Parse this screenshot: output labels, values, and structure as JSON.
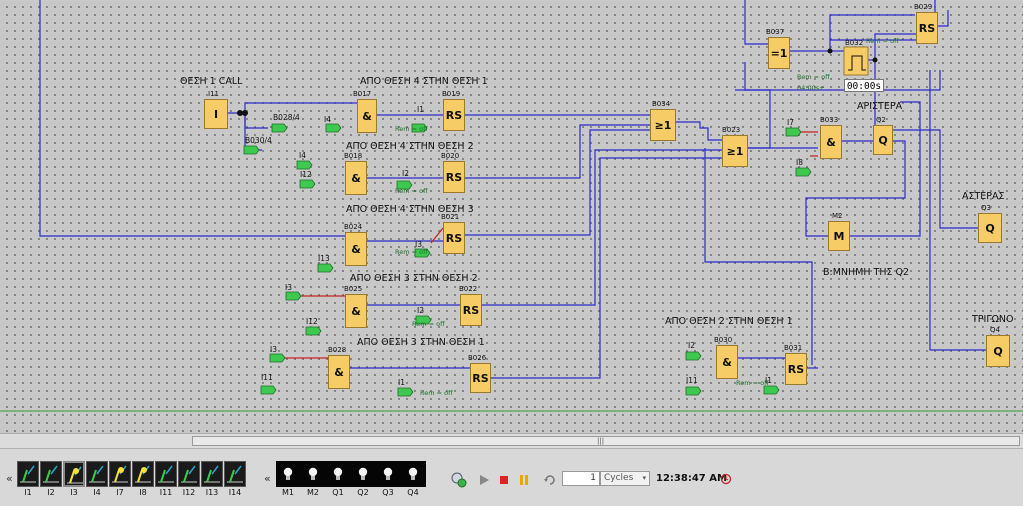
{
  "canvas": {
    "captions": [
      {
        "key": "c1",
        "text": "ΘΕΣΗ 1 CALL"
      },
      {
        "key": "c2",
        "text": "ΑΠΟ ΘΕΣΗ 4 ΣΤΗΝ ΘΕΣΗ 1"
      },
      {
        "key": "c3",
        "text": "ΑΠΟ ΘΕΣΗ 4 ΣΤΗΝ ΘΕΣΗ 2"
      },
      {
        "key": "c4",
        "text": "ΑΠΟ ΘΕΣΗ 4 ΣΤΗΝ ΘΕΣΗ 3"
      },
      {
        "key": "c5",
        "text": "ΑΠΟ ΘΕΣΗ 3 ΣΤΗΝ ΘΕΣΗ 2"
      },
      {
        "key": "c6",
        "text": "ΑΠΟ ΘΕΣΗ 3 ΣΤΗΝ ΘΕΣΗ 1"
      },
      {
        "key": "c7",
        "text": "ΑΠΟ ΘΕΣΗ 2 ΣΤΗΝ ΘΕΣΗ 1"
      },
      {
        "key": "c8",
        "text": "ΑΡΙΣΤΕΡΑ"
      },
      {
        "key": "c9",
        "text": "Β:ΜΝΗΜΗ ΤΗΣ Q2"
      },
      {
        "key": "c10",
        "text": "ΑΣΤΕΡΑΣ"
      },
      {
        "key": "c11",
        "text": "ΤΡΙΓΩΝΟ"
      }
    ],
    "blocks": [
      {
        "key": "I11",
        "id": "I11",
        "sym": "I"
      },
      {
        "key": "B017",
        "id": "B017",
        "sym": "&"
      },
      {
        "key": "B019",
        "id": "B019",
        "sym": "RS"
      },
      {
        "key": "B018",
        "id": "B018",
        "sym": "&"
      },
      {
        "key": "B020",
        "id": "B020",
        "sym": "RS"
      },
      {
        "key": "B024",
        "id": "B024",
        "sym": "&"
      },
      {
        "key": "B021",
        "id": "B021",
        "sym": "RS"
      },
      {
        "key": "B025",
        "id": "B025",
        "sym": "&"
      },
      {
        "key": "B022",
        "id": "B022",
        "sym": "RS"
      },
      {
        "key": "B028",
        "id": "B028",
        "sym": "&"
      },
      {
        "key": "B026",
        "id": "B026",
        "sym": "RS"
      },
      {
        "key": "B034",
        "id": "B034",
        "sym": "≥1"
      },
      {
        "key": "B023",
        "id": "B023",
        "sym": "≥1"
      },
      {
        "key": "B037",
        "id": "B037",
        "sym": "=1"
      },
      {
        "key": "B029",
        "id": "B029",
        "sym": "RS"
      },
      {
        "key": "B033",
        "id": "B033",
        "sym": "&"
      },
      {
        "key": "Q2",
        "id": "Q2",
        "sym": "Q"
      },
      {
        "key": "M2",
        "id": "M2",
        "sym": "M"
      },
      {
        "key": "Q3",
        "id": "Q3",
        "sym": "Q"
      },
      {
        "key": "Q4",
        "id": "Q4",
        "sym": "Q"
      },
      {
        "key": "B030",
        "id": "B030",
        "sym": "&"
      },
      {
        "key": "B031",
        "id": "B031",
        "sym": "RS"
      },
      {
        "key": "B032",
        "id": "B032",
        "sym": ""
      }
    ],
    "input_labels": [
      {
        "key": "a",
        "text": "B028/4"
      },
      {
        "key": "b",
        "text": "B030/4"
      },
      {
        "key": "c",
        "text": "I4"
      },
      {
        "key": "d",
        "text": "I1"
      },
      {
        "key": "e",
        "text": "I4"
      },
      {
        "key": "f",
        "text": "I12"
      },
      {
        "key": "g",
        "text": "I2"
      },
      {
        "key": "h",
        "text": "I3"
      },
      {
        "key": "i",
        "text": "I13"
      },
      {
        "key": "j",
        "text": "I3"
      },
      {
        "key": "k",
        "text": "I12"
      },
      {
        "key": "l",
        "text": "I2"
      },
      {
        "key": "m",
        "text": "I3"
      },
      {
        "key": "n",
        "text": "I11"
      },
      {
        "key": "o",
        "text": "I1"
      },
      {
        "key": "p",
        "text": "I7"
      },
      {
        "key": "q",
        "text": "I8"
      },
      {
        "key": "r",
        "text": "I2"
      },
      {
        "key": "s",
        "text": "I11"
      },
      {
        "key": "t",
        "text": "I1"
      }
    ],
    "rem_text": "Rem = off",
    "timer_value": "00:00s",
    "timer_param": "04:00s+"
  },
  "sim": {
    "inputs": [
      {
        "label": "I1",
        "on": false
      },
      {
        "label": "I2",
        "on": false
      },
      {
        "label": "I3",
        "on": true
      },
      {
        "label": "I4",
        "on": false
      },
      {
        "label": "I7",
        "on": true
      },
      {
        "label": "I8",
        "on": true
      },
      {
        "label": "I11",
        "on": false
      },
      {
        "label": "I12",
        "on": false
      },
      {
        "label": "I13",
        "on": false
      },
      {
        "label": "I14",
        "on": false
      }
    ],
    "outputs": [
      {
        "label": "M1"
      },
      {
        "label": "M2"
      },
      {
        "label": "Q1"
      },
      {
        "label": "Q2"
      },
      {
        "label": "Q3"
      },
      {
        "label": "Q4"
      }
    ],
    "cycles_value": "1",
    "cycles_unit": "Cycles",
    "time": "12:38:47 AM",
    "colors": {
      "wire": "#2b2bcc",
      "wire_red": "#cc2020",
      "block": "#f5cc66",
      "ground": "#2a9a3a"
    }
  }
}
